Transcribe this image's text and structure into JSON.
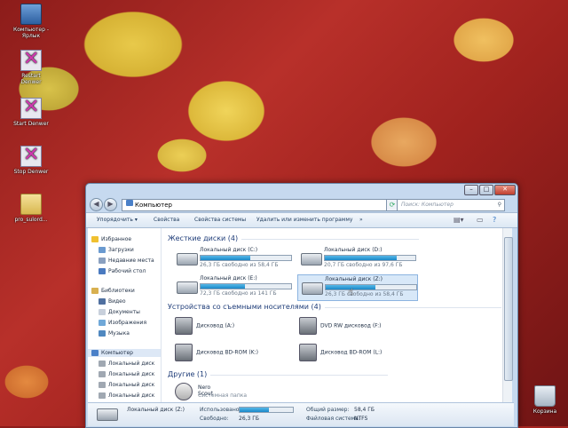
{
  "desktop_icons": [
    {
      "label": "Компьютер - Ярлык",
      "icon": "computer-shortcut-icon"
    },
    {
      "label": "Restart Denwer",
      "icon": "denwer-icon"
    },
    {
      "label": "Start Denwer",
      "icon": "denwer-icon"
    },
    {
      "label": "Stop Denwer",
      "icon": "denwer-icon"
    },
    {
      "label": "pro_sulord...",
      "icon": "folder-icon"
    },
    {
      "label": "Корзина",
      "icon": "recycle-bin-icon"
    }
  ],
  "explorer": {
    "address": "Компьютер",
    "search_placeholder": "Поиск: Компьютер",
    "toolbar": {
      "organize": "Упорядочить ▾",
      "properties": "Свойства",
      "system_properties": "Свойства системы",
      "uninstall": "Удалить или изменить программу",
      "more": "»"
    },
    "nav": {
      "favorites": "Избранное",
      "downloads": "Загрузки",
      "recent": "Недавние места",
      "desktop": "Рабочий стол",
      "libraries": "Библиотеки",
      "video": "Видео",
      "documents": "Документы",
      "pictures": "Изображения",
      "music": "Музыка",
      "computer": "Компьютер",
      "disk1": "Локальный диск",
      "disk2": "Локальный диск",
      "disk3": "Локальный диск",
      "disk4": "Локальный диск"
    },
    "groups": {
      "hdd": "Жесткие диски (4)",
      "removable": "Устройства со съемными носителями (4)",
      "other": "Другие (1)"
    },
    "drives": [
      {
        "name": "Локальный диск (C:)",
        "free": "26,3 ГБ свободно из 58,4 ГБ",
        "used_fraction": 0.55
      },
      {
        "name": "Локальный диск (D:)",
        "free": "20,7 ГБ свободно из 97,6 ГБ",
        "used_fraction": 0.79
      },
      {
        "name": "Локальный диск (E:)",
        "free": "72,3 ГБ свободно из 141 ГБ",
        "used_fraction": 0.49
      },
      {
        "name": "Локальный диск (Z:)",
        "free": "26,3 ГБ свободно из 58,4 ГБ",
        "used_fraction": 0.55
      }
    ],
    "devices": [
      {
        "name": "Дисковод (A:)"
      },
      {
        "name": "DVD RW дисковод (F:)"
      },
      {
        "name": "Дисковод BD-ROM (K:)"
      },
      {
        "name": "Дисковод BD-ROM (L:)"
      }
    ],
    "other": {
      "name": "Nero Scout",
      "type": "Системная папка"
    },
    "details": {
      "name": "Локальный диск (Z:)",
      "used_label": "Использовано:",
      "free_label": "Свободно:",
      "free_value": "26,3 ГБ",
      "total_label": "Общий размер:",
      "total_value": "58,4 ГБ",
      "fs_label": "Файловая система:",
      "fs_value": "NTFS",
      "used_fraction": 0.55
    }
  }
}
